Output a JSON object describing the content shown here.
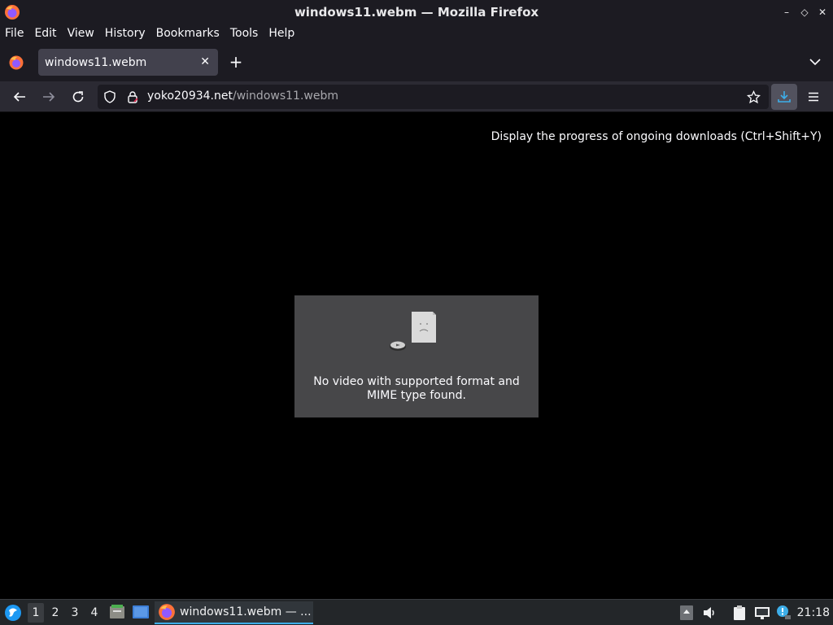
{
  "window": {
    "title": "windows11.webm — Mozilla Firefox"
  },
  "menubar": {
    "items": [
      "File",
      "Edit",
      "View",
      "History",
      "Bookmarks",
      "Tools",
      "Help"
    ]
  },
  "tabs": [
    {
      "title": "windows11.webm",
      "active": true
    }
  ],
  "navbar": {
    "url_host": "yoko20934.net",
    "url_path": "/windows11.webm"
  },
  "content": {
    "tooltip": "Display the progress of ongoing downloads (Ctrl+Shift+Y)",
    "error_line1": "No video with supported format and",
    "error_line2": "MIME type found."
  },
  "taskbar": {
    "workspaces": [
      "1",
      "2",
      "3",
      "4"
    ],
    "active_workspace": "1",
    "task_label": "windows11.webm — ...",
    "clock": "21:18"
  },
  "colors": {
    "accent_download": "#3daee9",
    "toolbar_bg": "#2b2a33",
    "tab_active_bg": "#42414d"
  }
}
